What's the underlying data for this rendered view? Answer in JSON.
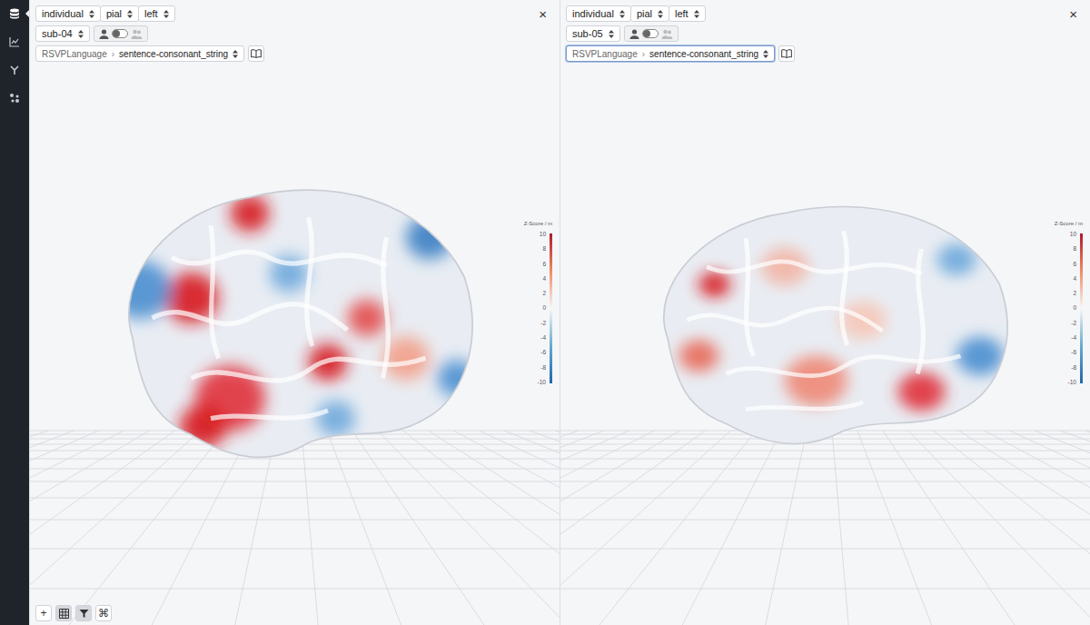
{
  "sidebar": {
    "items": [
      {
        "kind": "data",
        "selected": true
      },
      {
        "kind": "chart",
        "selected": false
      },
      {
        "kind": "graph",
        "selected": false
      },
      {
        "kind": "scatter",
        "selected": false
      }
    ]
  },
  "panels": [
    {
      "selectors": [
        "individual",
        "pial",
        "left"
      ],
      "close": "×",
      "subject": "sub-04",
      "toggle": {
        "on": false
      },
      "dataset": "RSVPLanguage",
      "separator": "›",
      "contrast": "sentence-consonant_string",
      "focused": false,
      "colorbar": {
        "title": "Z-Score / m",
        "ticks": [
          "10",
          "8",
          "6",
          "4",
          "2",
          "0",
          "-2",
          "-4",
          "-6",
          "-8",
          "-10"
        ]
      }
    },
    {
      "selectors": [
        "individual",
        "pial",
        "left"
      ],
      "close": "×",
      "subject": "sub-05",
      "toggle": {
        "on": false
      },
      "dataset": "RSVPLanguage",
      "separator": "›",
      "contrast": "sentence-consonant_string",
      "focused": true,
      "colorbar": {
        "title": "Z-Score / m",
        "ticks": [
          "10",
          "8",
          "6",
          "4",
          "2",
          "0",
          "-2",
          "-4",
          "-6",
          "-8",
          "-10"
        ]
      }
    }
  ],
  "toolbar": [
    {
      "kind": "text",
      "label": "+",
      "selected": false
    },
    {
      "kind": "grid",
      "label": "",
      "selected": true
    },
    {
      "kind": "filter",
      "label": "",
      "selected": true
    },
    {
      "kind": "text",
      "label": "⌘",
      "selected": false
    }
  ]
}
